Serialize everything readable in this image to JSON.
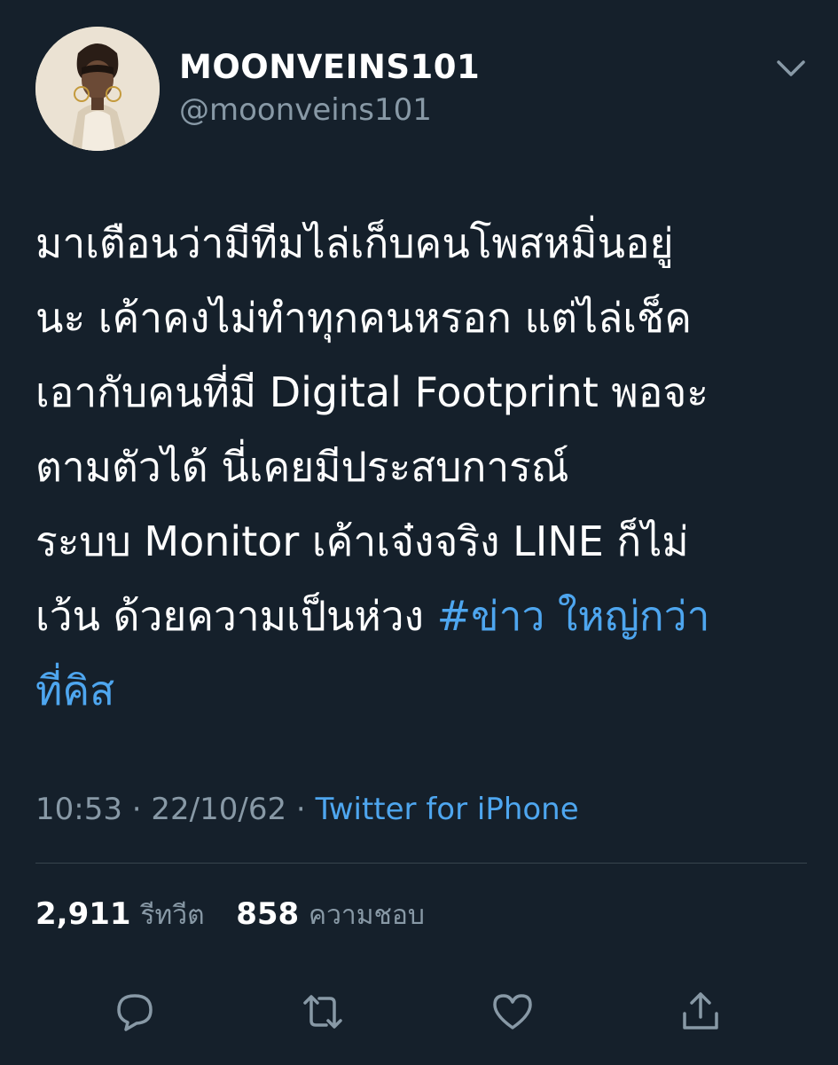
{
  "user": {
    "display_name": "MOONVEINS101",
    "handle": "@moonveins101"
  },
  "tweet": {
    "lines": [
      "มาเตือนว่ามีทีมไล่เก็บคนโพสหมิ่นอยู่",
      "นะ เค้าคงไม่ทำทุกคนหรอก แต่ไล่เช็ค",
      "เอากับคนที่มี Digital Footprint พอจะ",
      "ตามตัวได้ นี่เคยมีประสบการณ์",
      "ระบบ Monitor เค้าเจ๋งจริง LINE ก็ไม่"
    ],
    "line6_text": "เว้น ด้วยความเป็นห่วง ",
    "hashtag_part1": "#ข่าว ใหญ่กว่า",
    "hashtag_part2": "ที่คิส"
  },
  "meta": {
    "time": "10:53",
    "separator": " · ",
    "date": "22/10/62",
    "separator2": " · ",
    "source": "Twitter for iPhone"
  },
  "stats": {
    "retweets_count": "2,911",
    "retweets_label": "รีทวีต",
    "likes_count": "858",
    "likes_label": "ความชอบ"
  },
  "actions": {
    "reply_icon": "reply-icon",
    "retweet_icon": "retweet-icon",
    "like_icon": "heart-icon",
    "share_icon": "share-icon"
  },
  "colors": {
    "background": "#15202b",
    "link": "#4ea6ef",
    "secondary_text": "#8899a6"
  }
}
